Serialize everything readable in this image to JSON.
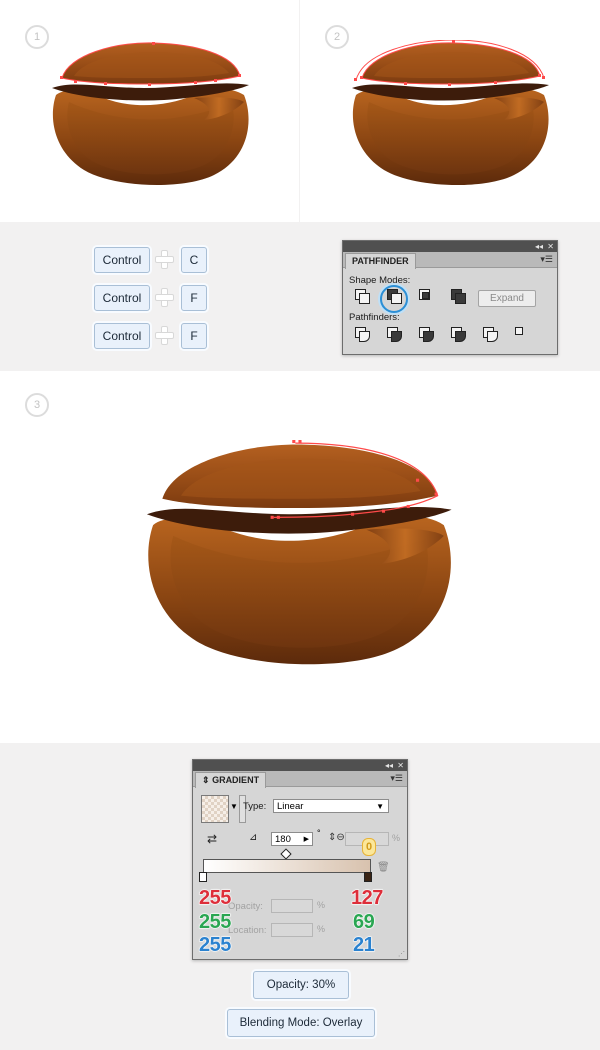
{
  "steps": {
    "one": "1",
    "two": "2",
    "three": "3"
  },
  "shortcuts": [
    {
      "mod": "Control",
      "key": "C"
    },
    {
      "mod": "Control",
      "key": "F"
    },
    {
      "mod": "Control",
      "key": "F"
    }
  ],
  "pathfinder": {
    "title": "PATHFINDER",
    "shape_modes_label": "Shape Modes:",
    "pathfinders_label": "Pathfinders:",
    "expand_label": "Expand"
  },
  "gradient": {
    "title": "GRADIENT",
    "type_label": "Type:",
    "type_value": "Linear",
    "angle_value": "180",
    "degree_symbol": "°",
    "aspect_value": "0",
    "percent": "%",
    "opacity_label": "Opacity:",
    "location_label": "Location:",
    "left_stop": {
      "r": "255",
      "g": "255",
      "b": "255"
    },
    "right_stop": {
      "r": "127",
      "g": "69",
      "b": "21"
    }
  },
  "notes": {
    "opacity": "Opacity: 30%",
    "blending": "Blending Mode: Overlay"
  },
  "colors": {
    "bean_light": "#b5611c",
    "bean_dark": "#6a3310",
    "bean_gap": "#3a1a0b",
    "path_red": "#ff4a4a",
    "highlight_blue": "#2b8fd6"
  },
  "icons": [
    "unite-icon",
    "minus-front-icon",
    "intersect-icon",
    "exclude-icon",
    "divide-icon",
    "trim-icon",
    "merge-icon",
    "crop-icon",
    "outline-icon",
    "minus-back-icon",
    "swap-icon",
    "angle-icon",
    "aspect-ratio-icon",
    "trash-icon",
    "collapse-icon",
    "close-icon",
    "panel-menu-icon",
    "dropdown-icon"
  ]
}
